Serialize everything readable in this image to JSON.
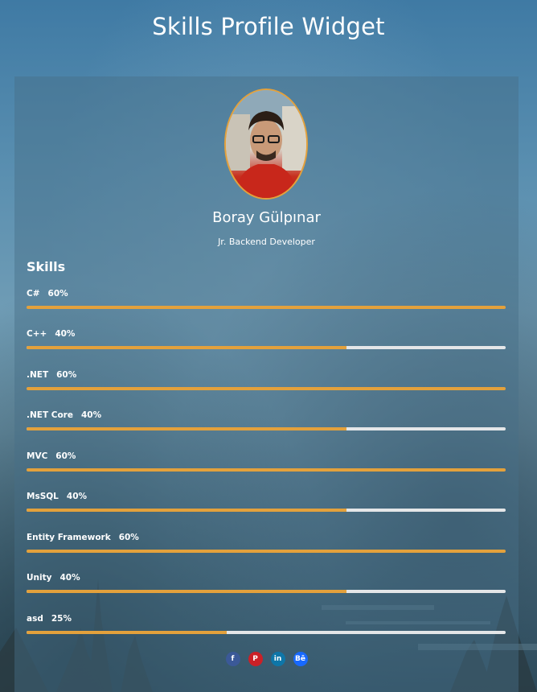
{
  "page": {
    "title": "Skills Profile Widget"
  },
  "profile": {
    "name": "Boray Gülpınar",
    "role": "Jr. Backend Developer"
  },
  "skills_heading": "Skills",
  "skills": [
    {
      "name": "C#",
      "percent_label": "60%",
      "level": 1.0
    },
    {
      "name": "C++",
      "percent_label": "40%",
      "level": 0.667
    },
    {
      "name": ".NET",
      "percent_label": "60%",
      "level": 1.0
    },
    {
      "name": ".NET Core",
      "percent_label": "40%",
      "level": 0.667
    },
    {
      "name": "MVC",
      "percent_label": "60%",
      "level": 1.0
    },
    {
      "name": "MsSQL",
      "percent_label": "40%",
      "level": 0.667
    },
    {
      "name": "Entity Framework",
      "percent_label": "60%",
      "level": 1.0
    },
    {
      "name": "Unity",
      "percent_label": "40%",
      "level": 0.667
    },
    {
      "name": "asd",
      "percent_label": "25%",
      "level": 0.417
    }
  ],
  "social": [
    {
      "icon": "facebook-icon",
      "glyph": "f",
      "color": "#3b5998"
    },
    {
      "icon": "pinterest-icon",
      "glyph": "P",
      "color": "#cb2027"
    },
    {
      "icon": "linkedin-icon",
      "glyph": "in",
      "color": "#0e76a8"
    },
    {
      "icon": "behance-icon",
      "glyph": "Bē",
      "color": "#1769ff"
    }
  ],
  "colors": {
    "accent": "#e3a13c",
    "track": "#e4e6e8"
  }
}
